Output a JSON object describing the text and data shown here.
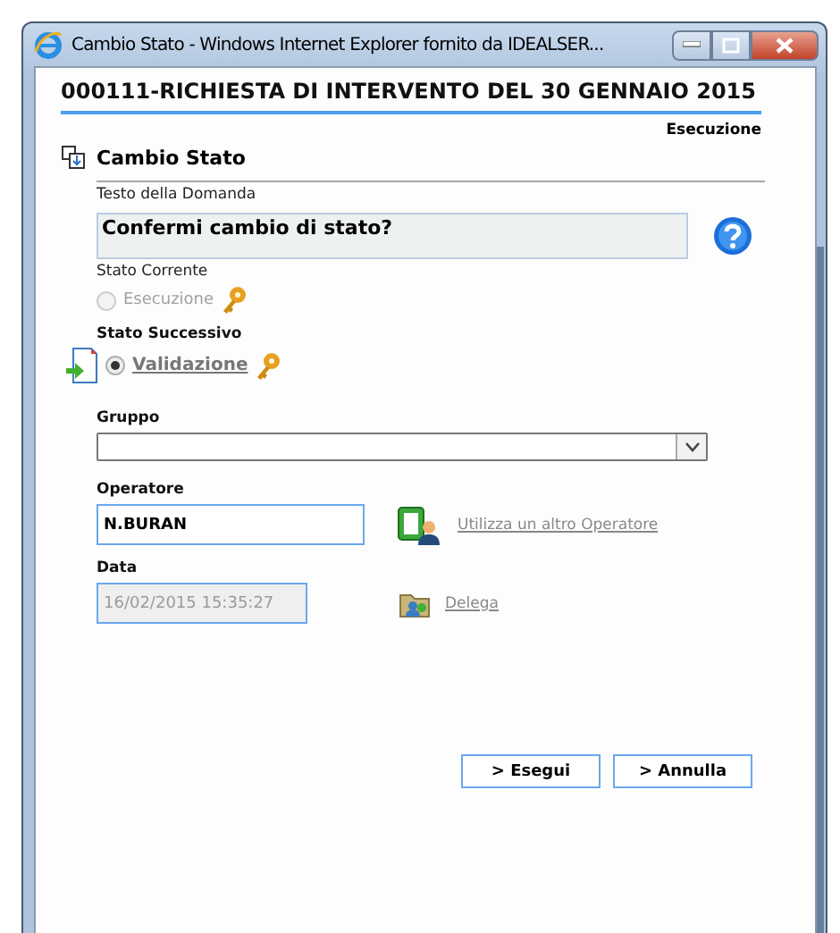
{
  "window": {
    "title": "Cambio Stato - Windows Internet Explorer fornito da IDEALSER..."
  },
  "header": {
    "title": "000111-RICHIESTA DI INTERVENTO DEL 30 GENNAIO 2015",
    "status": "Esecuzione"
  },
  "section": {
    "title": "Cambio Stato"
  },
  "question": {
    "label": "Testo della Domanda",
    "value": "Confermi cambio di stato?"
  },
  "current_state": {
    "label": "Stato Corrente",
    "option": {
      "label": "Esecuzione",
      "selected": false,
      "disabled": true
    }
  },
  "next_state": {
    "label": "Stato Successivo",
    "option": {
      "label": "Validazione",
      "selected": true,
      "disabled": false
    }
  },
  "group": {
    "label": "Gruppo"
  },
  "operator": {
    "label": "Operatore",
    "value": "N.BURAN",
    "link": "Utilizza un altro Operatore"
  },
  "date": {
    "label": "Data",
    "value": "16/02/2015 15:35:27",
    "disabled": true,
    "link": "Delega"
  },
  "buttons": [
    {
      "label": "> Esegui"
    },
    {
      "label": "> Annulla"
    }
  ]
}
